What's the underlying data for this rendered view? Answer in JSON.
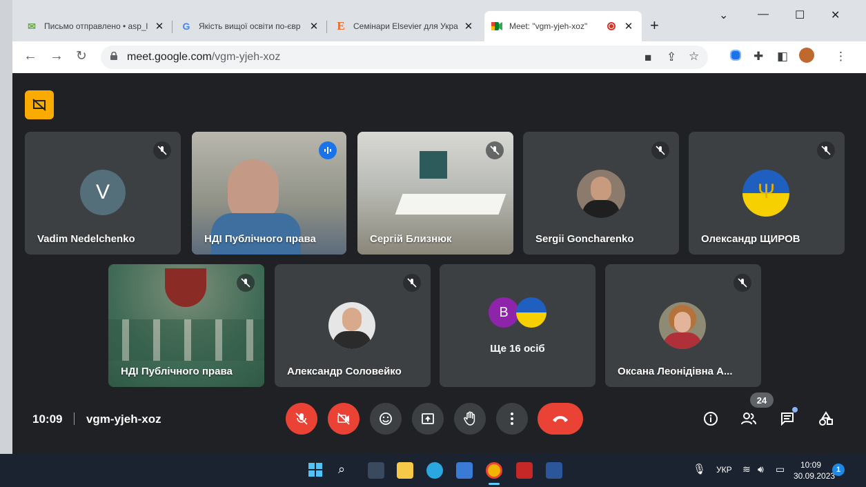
{
  "tabs": [
    {
      "title": "Письмо отправлено • asp_l",
      "favicon": "mail-ru-icon",
      "color": "#6aa84f"
    },
    {
      "title": "Якість вищої освіти по-євр",
      "favicon": "google-icon",
      "color": "#4285f4"
    },
    {
      "title": "Семінари Elsevier для Укра",
      "favicon": "elsevier-icon",
      "color": "#f26522"
    },
    {
      "title": "Meet: \"vgm-yjeh-xoz\"",
      "favicon": "meet-icon",
      "color": "#00832d",
      "active": true
    }
  ],
  "window_controls": {
    "chevron": "⌄",
    "minimize": "—",
    "maximize": "☐",
    "close": "✕"
  },
  "url": {
    "host": "meet.google.com",
    "path": "/vgm-yjeh-xoz"
  },
  "presenting_badge": {
    "icon": "present-off-icon",
    "color": "#f9ab00"
  },
  "participants_row1": [
    {
      "name": "Vadim Nedelchenko",
      "kind": "letter",
      "letter": "V",
      "avatar_color": "#546e7a",
      "muted": true
    },
    {
      "name": "НДІ Публічного права",
      "kind": "video",
      "speaking": true,
      "muted": false
    },
    {
      "name": "Сергій Близнюк",
      "kind": "video-room",
      "muted": true
    },
    {
      "name": "Sergii Goncharenko",
      "kind": "photo",
      "muted": true
    },
    {
      "name": "Олександр ЩИРОВ",
      "kind": "flag",
      "muted": true
    }
  ],
  "participants_row2": [
    {
      "name": "НДІ Публічного права",
      "kind": "banner",
      "muted": true
    },
    {
      "name": "Александр Соловейко",
      "kind": "photo",
      "muted": true
    },
    {
      "name": "Ще 16 осіб",
      "kind": "others",
      "letter": "B"
    },
    {
      "name": "Оксана Леонідівна А...",
      "kind": "photo-woman",
      "muted": true
    }
  ],
  "meeting": {
    "time": "10:09",
    "code": "vgm-yjeh-xoz",
    "participant_count": "24"
  },
  "controls": [
    "mic-off-icon",
    "camera-off-icon",
    "emoji-icon",
    "present-icon",
    "raise-hand-icon",
    "more-icon"
  ],
  "taskbar": {
    "lang": "УКР",
    "time": "10:09",
    "date": "30.09.2023",
    "notification_count": "1"
  }
}
